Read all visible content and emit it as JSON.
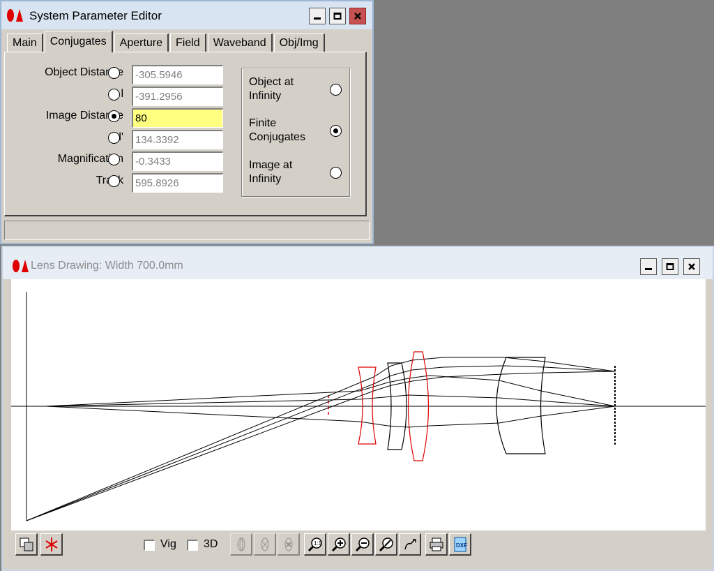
{
  "editor": {
    "title": "System Parameter Editor",
    "tabs": [
      "Main",
      "Conjugates",
      "Aperture",
      "Field",
      "Waveband",
      "Obj/Img"
    ],
    "active_tab": "Conjugates",
    "params": [
      {
        "label": "Object Distance",
        "value": "-305.5946",
        "selected": false
      },
      {
        "label": "l",
        "value": "-391.2956",
        "selected": false
      },
      {
        "label": "Image Distance",
        "value": "80",
        "selected": true
      },
      {
        "label": "l'",
        "value": "134.3392",
        "selected": false
      },
      {
        "label": "Magnification",
        "value": "-0.3433",
        "selected": false
      },
      {
        "label": "Track",
        "value": "595.8926",
        "selected": false
      }
    ],
    "conjugate_options": [
      {
        "line1": "Object at",
        "line2": "Infinity",
        "selected": false
      },
      {
        "line1": "Finite",
        "line2": "Conjugates",
        "selected": true
      },
      {
        "line1": "Image at",
        "line2": "Infinity",
        "selected": false
      }
    ],
    "status": ""
  },
  "lens_window": {
    "title": "Lens Drawing: Width  700.0mm",
    "checkboxes": [
      {
        "label": "Vig",
        "checked": false
      },
      {
        "label": "3D",
        "checked": false
      }
    ],
    "toolbar_icons": [
      "edit-surface-icon",
      "flip-icon",
      "lens-view-1-icon",
      "lens-view-2-icon",
      "lens-view-3-icon",
      "zoom-reset-icon",
      "zoom-in-icon",
      "zoom-out-icon",
      "zoom-fit-icon",
      "pan-icon",
      "print-icon",
      "export-dxf-icon"
    ]
  },
  "colors": {
    "ray": "#000000",
    "selected_lens": "#e00000",
    "lens": "#000000",
    "active_field": "#ffff80"
  }
}
